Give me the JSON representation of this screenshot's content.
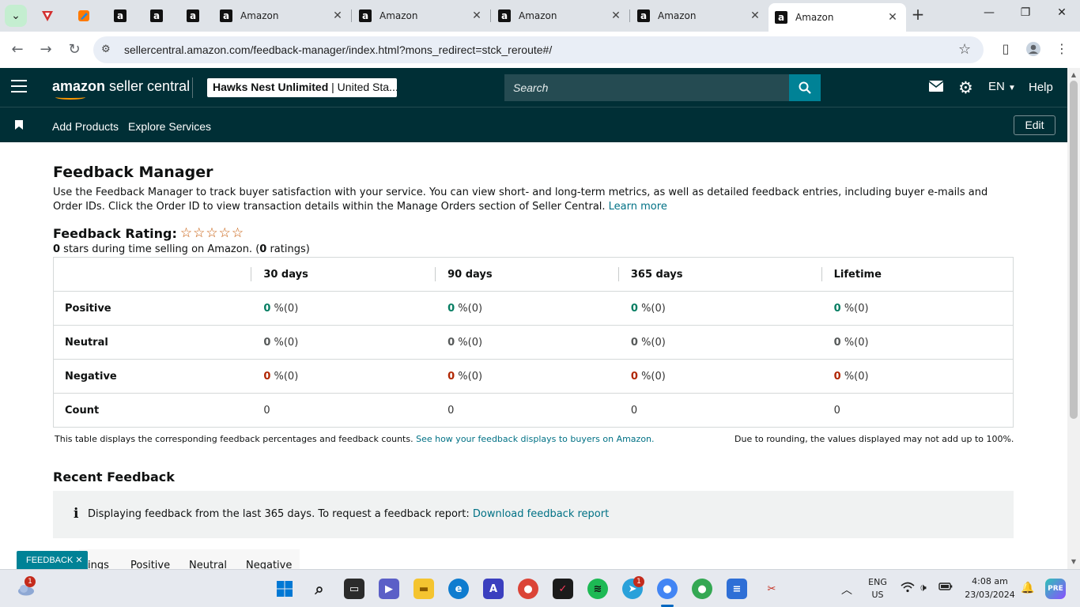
{
  "browser": {
    "tabs": [
      {
        "title": "Amazon"
      },
      {
        "title": "Amazon"
      },
      {
        "title": "Amazon"
      },
      {
        "title": "Amazon"
      },
      {
        "title": "Amazon"
      }
    ],
    "url": "sellercentral.amazon.com/feedback-manager/index.html?mons_redirect=stck_reroute#/"
  },
  "header": {
    "logo_brand": "amazon",
    "logo_rest": " seller central",
    "account_name": "Hawks Nest Unlimited",
    "account_region": " | United Sta...",
    "search_placeholder": "Search",
    "language": "EN",
    "help": "Help",
    "nav": [
      "Add Products",
      "Explore Services"
    ],
    "edit": "Edit"
  },
  "page": {
    "title": "Feedback Manager",
    "intro": "Use the Feedback Manager to track buyer satisfaction with your service. You can view short- and long-term metrics, as well as detailed feedback entries, including buyer e-mails and Order IDs. Click the Order ID to view transaction details within the Manage Orders section of Seller Central.",
    "learn_more": "Learn more",
    "rating_label": "Feedback Rating:",
    "rating_stars": "☆☆☆☆☆",
    "rating_value": "0",
    "rating_summary_mid": " stars during time selling on Amazon. (",
    "rating_count": "0",
    "rating_summary_end": " ratings)",
    "table": {
      "columns": [
        "30 days",
        "90 days",
        "365 days",
        "Lifetime"
      ],
      "rows": [
        {
          "label": "Positive",
          "values": [
            "0",
            "0",
            "0",
            "0"
          ],
          "suffix": "%(0)"
        },
        {
          "label": "Neutral",
          "values": [
            "0",
            "0",
            "0",
            "0"
          ],
          "suffix": "%(0)"
        },
        {
          "label": "Negative",
          "values": [
            "0",
            "0",
            "0",
            "0"
          ],
          "suffix": "%(0)"
        },
        {
          "label": "Count",
          "values": [
            "0",
            "0",
            "0",
            "0"
          ]
        }
      ]
    },
    "note_left": "This table displays the corresponding feedback percentages and feedback counts.",
    "note_link": "See how your feedback displays to buyers on Amazon.",
    "note_right": "Due to rounding, the values displayed may not add up to 100%.",
    "recent_title": "Recent Feedback",
    "info_text": "Displaying feedback from the last 365 days. To request a feedback report:",
    "info_link": "Download feedback report",
    "sub_tabs": [
      "ings",
      "Positive",
      "Neutral",
      "Negative"
    ],
    "feedback_pill": "FEEDBACK"
  },
  "taskbar": {
    "lang_top": "ENG",
    "lang_bottom": "US",
    "time": "4:08 am",
    "date": "23/03/2024",
    "badge_weather": "1",
    "badge_telegram": "1"
  },
  "colors": {
    "header_bg": "#002f36",
    "accent_teal": "#008296",
    "positive": "#067d62",
    "negative": "#b12704",
    "link": "#007185"
  }
}
